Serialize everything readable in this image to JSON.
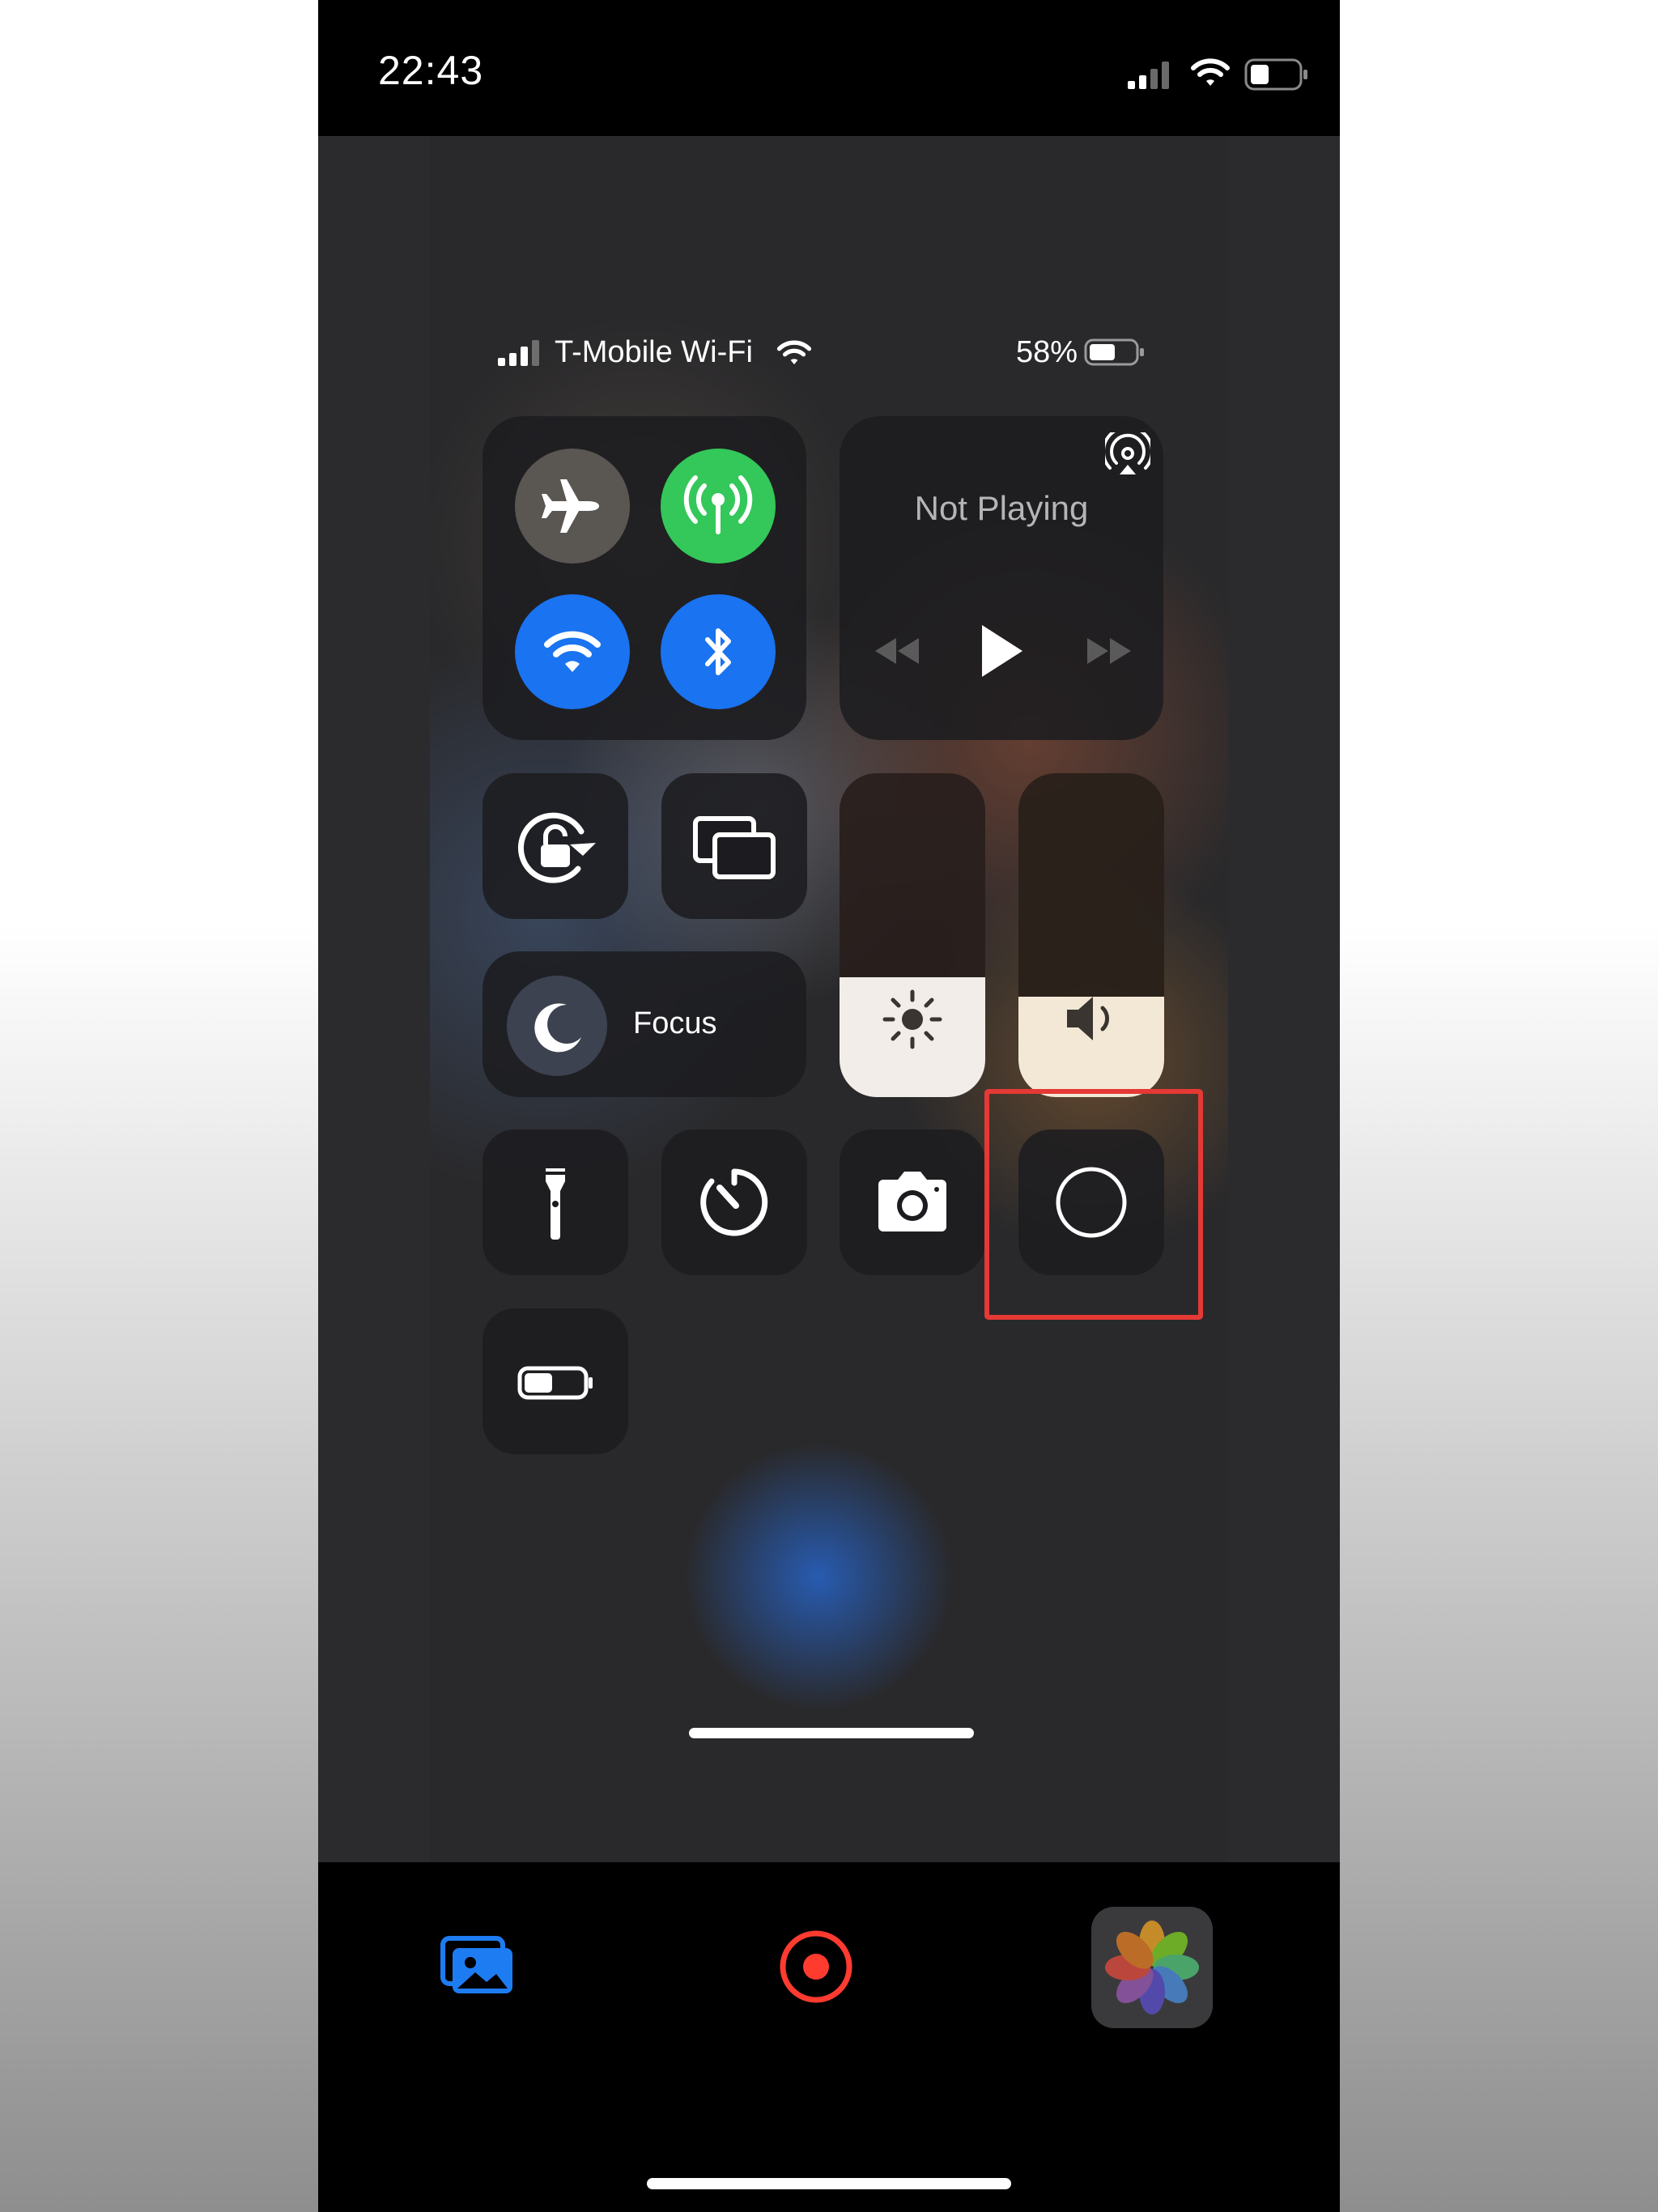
{
  "status_bar": {
    "time": "22:43",
    "icons": [
      "cellular-signal-icon",
      "wifi-icon",
      "battery-icon"
    ]
  },
  "control_center": {
    "status": {
      "carrier": "T-Mobile Wi-Fi",
      "battery_percent": "58%",
      "battery_level": 0.58
    },
    "connectivity": {
      "airplane_mode": false,
      "cellular_data": true,
      "wifi": true,
      "bluetooth": true
    },
    "now_playing": {
      "title": "Not Playing"
    },
    "focus": {
      "label": "Focus"
    },
    "brightness_level": 0.37,
    "volume_level": 0.31,
    "shortcuts": [
      "flashlight-icon",
      "timer-icon",
      "camera-icon",
      "screen-record-icon",
      "low-power-mode-icon"
    ]
  },
  "colors": {
    "cellular_green": "#34c759",
    "ios_blue": "#1a73f0",
    "highlight_red": "#e53935",
    "record_red": "#ff3b30",
    "app_tab_blue": "#1e7cf2"
  },
  "bottom_toolbar": {
    "icons": [
      "gallery-icon",
      "record-icon",
      "photos-app-icon"
    ]
  }
}
